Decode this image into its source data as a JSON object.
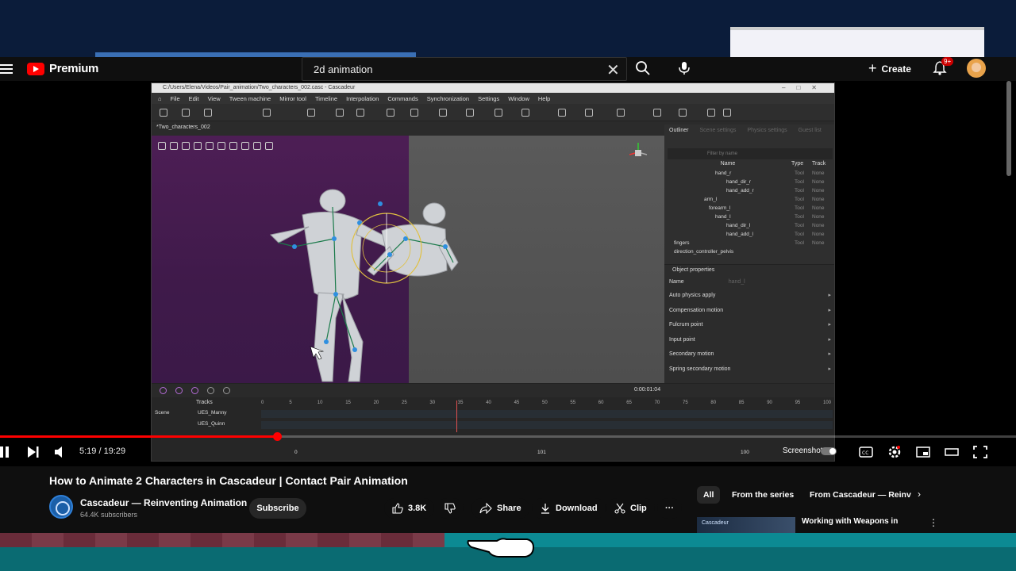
{
  "youtube": {
    "logo_text": "Premium",
    "search_value": "2d animation",
    "create_label": "Create",
    "notif_count": "9+"
  },
  "cascadeur": {
    "window_title": "C:/Users/Elena/Videos/Pair_animation/Two_characters_002.casc - Cascadeur",
    "scene_tab": "*Two_characters_002",
    "menu": [
      "File",
      "Edit",
      "View",
      "Tween machine",
      "Mirror tool",
      "Timeline",
      "Interpolation",
      "Commands",
      "Synchronization",
      "Settings",
      "Window",
      "Help"
    ],
    "panel_tabs": [
      "Outliner",
      "Scene settings",
      "Physics settings",
      "Guest list"
    ],
    "filter_placeholder": "Filter by name",
    "outliner_headers": {
      "name": "Name",
      "type": "Type",
      "track": "Track"
    },
    "outliner_rows": [
      {
        "indent": 64,
        "name": "hand_r",
        "type": "Tool",
        "track": "None"
      },
      {
        "indent": 78,
        "name": "hand_dir_r",
        "type": "Tool",
        "track": "None"
      },
      {
        "indent": 78,
        "name": "hand_add_r",
        "type": "Tool",
        "track": "None"
      },
      {
        "indent": 50,
        "name": "arm_l",
        "type": "Tool",
        "track": "None"
      },
      {
        "indent": 56,
        "name": "forearm_l",
        "type": "Tool",
        "track": "None"
      },
      {
        "indent": 64,
        "name": "hand_l",
        "type": "Tool",
        "track": "None"
      },
      {
        "indent": 78,
        "name": "hand_dir_l",
        "type": "Tool",
        "track": "None"
      },
      {
        "indent": 78,
        "name": "hand_add_l",
        "type": "Tool",
        "track": "None"
      },
      {
        "indent": 12,
        "name": "fingers",
        "type": "Tool",
        "track": "None"
      },
      {
        "indent": 12,
        "name": "direction_controller_pelvis",
        "type": "",
        "track": ""
      }
    ],
    "object_properties": {
      "title": "Object properties",
      "name_label": "Name",
      "name_value": "hand_l",
      "sections": [
        "Auto physics apply",
        "Compensation motion",
        "Fulcrum point",
        "Input point",
        "Secondary motion",
        "Spring secondary motion"
      ]
    },
    "timeline": {
      "time": "0:00:01:04",
      "tracks_label": "Tracks",
      "track_names": [
        "Scene",
        "UES_Manny",
        "UES_Quinn"
      ],
      "ruler": [
        "0",
        "5",
        "10",
        "15",
        "20",
        "25",
        "30",
        "35",
        "40",
        "45",
        "50",
        "55",
        "60",
        "65",
        "70",
        "75",
        "80",
        "85",
        "90",
        "95",
        "100"
      ],
      "current_frame": "25",
      "footer_left": "0",
      "footer_mid": "101",
      "footer_right": "100"
    }
  },
  "player": {
    "time": "5:19 / 19:29",
    "progress_fraction": 0.2729,
    "screenshot_label": "Screenshot"
  },
  "video": {
    "title": "How to Animate 2 Characters in Cascadeur | Contact Pair Animation",
    "channel": "Cascadeur — Reinventing Animation",
    "subscribers": "64.4K subscribers",
    "subscribe_label": "Subscribe",
    "likes": "3.8K",
    "share_label": "Share",
    "download_label": "Download",
    "clip_label": "Clip",
    "more_label": "···"
  },
  "recommendations": {
    "chips": [
      "All",
      "From the series",
      "From Cascadeur — Reinv"
    ],
    "first": {
      "thumb_text": "Cascadeur",
      "title": "Working with Weapons in"
    }
  },
  "colors": {
    "accent": "#ff0000",
    "viewport_purple": "#4d1e55"
  }
}
